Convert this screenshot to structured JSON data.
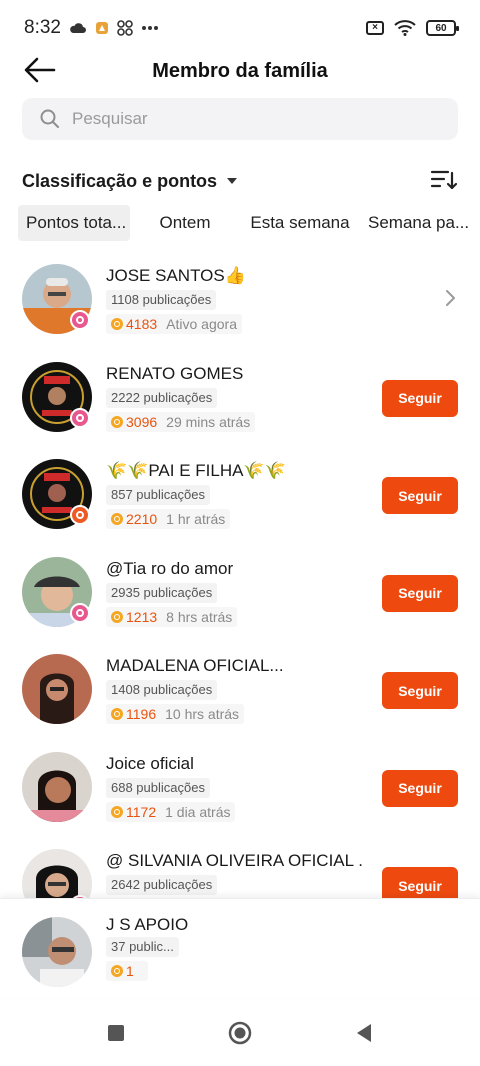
{
  "status_bar": {
    "time": "8:32",
    "battery": "60",
    "icons": [
      "cloud-icon",
      "app-notification-icon",
      "apps-icon",
      "more-dots-icon",
      "sim-off-icon",
      "wifi-icon",
      "battery-icon"
    ]
  },
  "header": {
    "title": "Membro da família"
  },
  "search": {
    "placeholder": "Pesquisar"
  },
  "sort": {
    "label": "Classificação e pontos"
  },
  "tabs": [
    "Pontos tota...",
    "Ontem",
    "Esta semana",
    "Semana pa..."
  ],
  "members": [
    {
      "name": "JOSE SANTOS👍",
      "pubs": "1108 publicações",
      "points": "4183",
      "ago": "Ativo agora",
      "action": "chevron",
      "badge": "#e8578e"
    },
    {
      "name": "RENATO GOMES",
      "pubs": "2222 publicações",
      "points": "3096",
      "ago": "29 mins atrás",
      "action": "Seguir",
      "badge": "#e8578e"
    },
    {
      "name": "🌾🌾PAI E FILHA🌾🌾",
      "pubs": "857 publicações",
      "points": "2210",
      "ago": "1 hr atrás",
      "action": "Seguir",
      "badge": "#ee5a24"
    },
    {
      "name": "@Tia ro do amor",
      "pubs": "2935 publicações",
      "points": "1213",
      "ago": "8 hrs atrás",
      "action": "Seguir",
      "badge": "#e8578e"
    },
    {
      "name": "MADALENA OFICIAL...",
      "pubs": "1408 publicações",
      "points": "1196",
      "ago": "10 hrs atrás",
      "action": "Seguir",
      "badge": ""
    },
    {
      "name": "Joice oficial",
      "pubs": "688 publicações",
      "points": "1172",
      "ago": "1 dia atrás",
      "action": "Seguir",
      "badge": ""
    },
    {
      "name": "@ SILVANIA OLIVEIRA OFICIAL .",
      "pubs": "2642 publicações",
      "points": "",
      "ago": "",
      "action": "Seguir",
      "badge": "#e8578e"
    }
  ],
  "me": {
    "name": "J S APOIO",
    "pubs": "37 public...",
    "points": "1"
  },
  "colors": {
    "accent": "#ee4a10",
    "points": "#e8540f",
    "coin": "#f5a623"
  }
}
